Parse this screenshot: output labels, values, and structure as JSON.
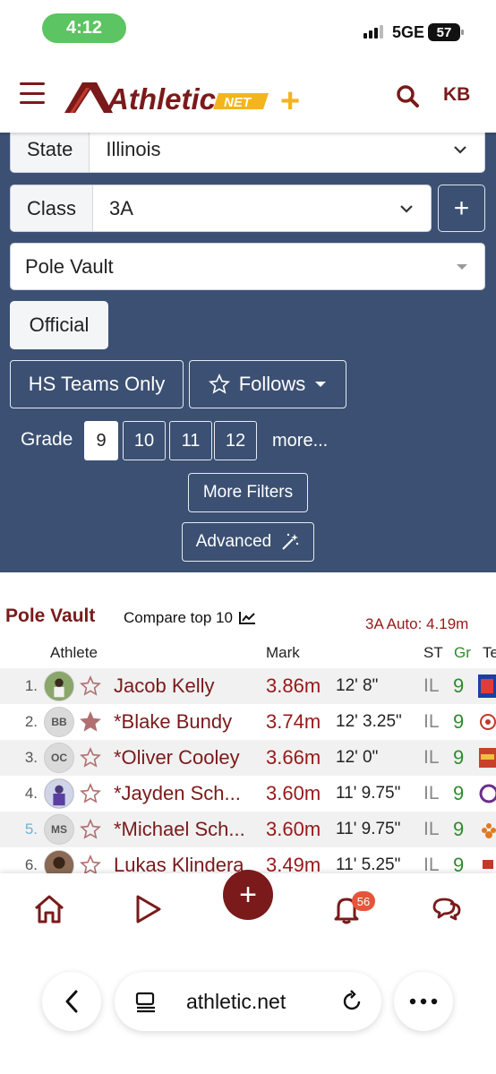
{
  "status_bar": {
    "time": "4:12",
    "network": "5GE",
    "battery": "57"
  },
  "header": {
    "logo_text": "Athletic",
    "logo_net": "NET",
    "logo_plus": "+",
    "user_initials": "KB"
  },
  "filters": {
    "state_label": "State",
    "state_value": "Illinois",
    "class_label": "Class",
    "class_value": "3A",
    "class_add": "+",
    "event_value": "Pole Vault",
    "official_label": "Official",
    "hs_teams_label": "HS Teams Only",
    "follows_label": "Follows",
    "grade_label": "Grade",
    "grades": [
      "9",
      "10",
      "11",
      "12"
    ],
    "grade_selected": "9",
    "grade_more": "more...",
    "more_filters_label": "More Filters",
    "advanced_label": "Advanced"
  },
  "results": {
    "title": "Pole Vault",
    "compare_label": "Compare top 10",
    "auto_label": "3A Auto: 4.19m",
    "columns": {
      "athlete": "Athlete",
      "mark": "Mark",
      "st": "ST",
      "gr": "Gr",
      "team": "Te"
    },
    "rows": [
      {
        "rank": "1.",
        "initials": "",
        "starred": false,
        "name": "Jacob Kelly",
        "mark": "3.86m",
        "imperial": "12' 8\"",
        "st": "IL",
        "gr": "9"
      },
      {
        "rank": "2.",
        "initials": "BB",
        "starred": true,
        "name": "*Blake Bundy",
        "mark": "3.74m",
        "imperial": "12' 3.25\"",
        "st": "IL",
        "gr": "9"
      },
      {
        "rank": "3.",
        "initials": "OC",
        "starred": false,
        "name": "*Oliver Cooley",
        "mark": "3.66m",
        "imperial": "12' 0\"",
        "st": "IL",
        "gr": "9"
      },
      {
        "rank": "4.",
        "initials": "",
        "starred": false,
        "name": "*Jayden Sch...",
        "mark": "3.60m",
        "imperial": "11' 9.75\"",
        "st": "IL",
        "gr": "9"
      },
      {
        "rank": "5.",
        "initials": "MS",
        "starred": false,
        "name": "*Michael Sch...",
        "mark": "3.60m",
        "imperial": "11' 9.75\"",
        "st": "IL",
        "gr": "9"
      },
      {
        "rank": "6.",
        "initials": "",
        "starred": false,
        "name": "Lukas Klindera",
        "mark": "3.49m",
        "imperial": "11' 5.25\"",
        "st": "IL",
        "gr": "9"
      }
    ]
  },
  "bottom_nav": {
    "fab": "+",
    "notification_count": "56"
  },
  "browser": {
    "url": "athletic.net"
  },
  "colors": {
    "brand": "#7a1a1a",
    "panel": "#3b5072",
    "grade_green": "#2e8b2e",
    "logo_gold": "#f2b51d"
  }
}
